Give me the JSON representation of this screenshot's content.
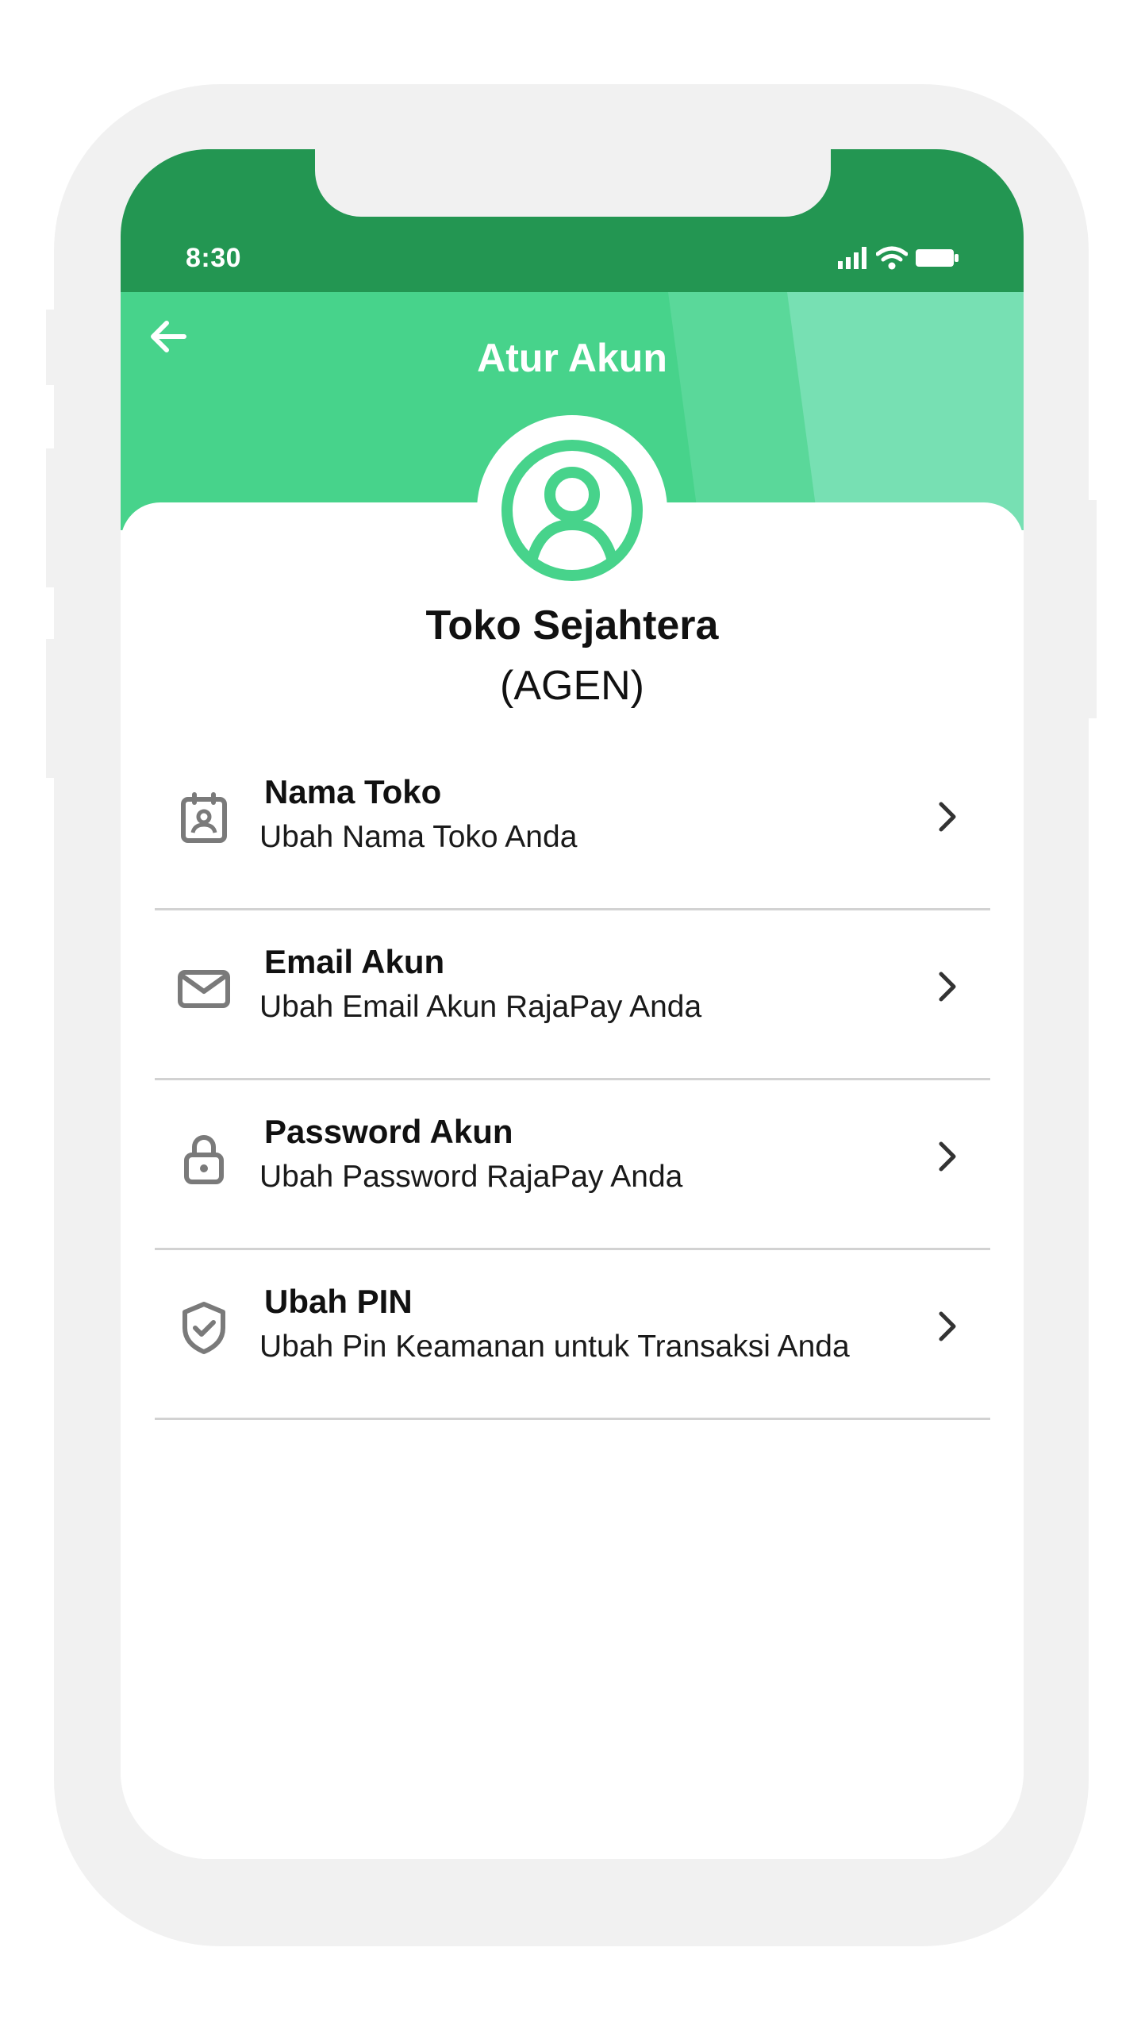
{
  "status_bar": {
    "time": "8:30",
    "icons": [
      "signal-icon",
      "wifi-icon",
      "battery-icon"
    ]
  },
  "header": {
    "title": "Atur Akun",
    "back_icon": "arrow-left-icon"
  },
  "profile": {
    "avatar_icon": "user-circle-icon",
    "name": "Toko Sejahtera",
    "role": "(AGEN)"
  },
  "menu": {
    "items": [
      {
        "icon": "store-badge-icon",
        "title": "Nama Toko",
        "subtitle": "Ubah Nama Toko Anda"
      },
      {
        "icon": "mail-icon",
        "title": "Email Akun",
        "subtitle": "Ubah Email Akun RajaPay Anda"
      },
      {
        "icon": "lock-icon",
        "title": "Password Akun",
        "subtitle": "Ubah Password RajaPay Anda"
      },
      {
        "icon": "shield-check-icon",
        "title": "Ubah PIN",
        "subtitle": "Ubah Pin Keamanan untuk Transaksi Anda"
      }
    ]
  },
  "colors": {
    "status_bar": "#239652",
    "header": "#47d38b",
    "header_stripe_1": "#5ad89a",
    "header_stripe_2": "#77e0b3",
    "avatar": "#47d38b",
    "menu_icon": "#7a7a7a",
    "divider": "#d2d2d2",
    "bezel": "#f1f1f1"
  }
}
